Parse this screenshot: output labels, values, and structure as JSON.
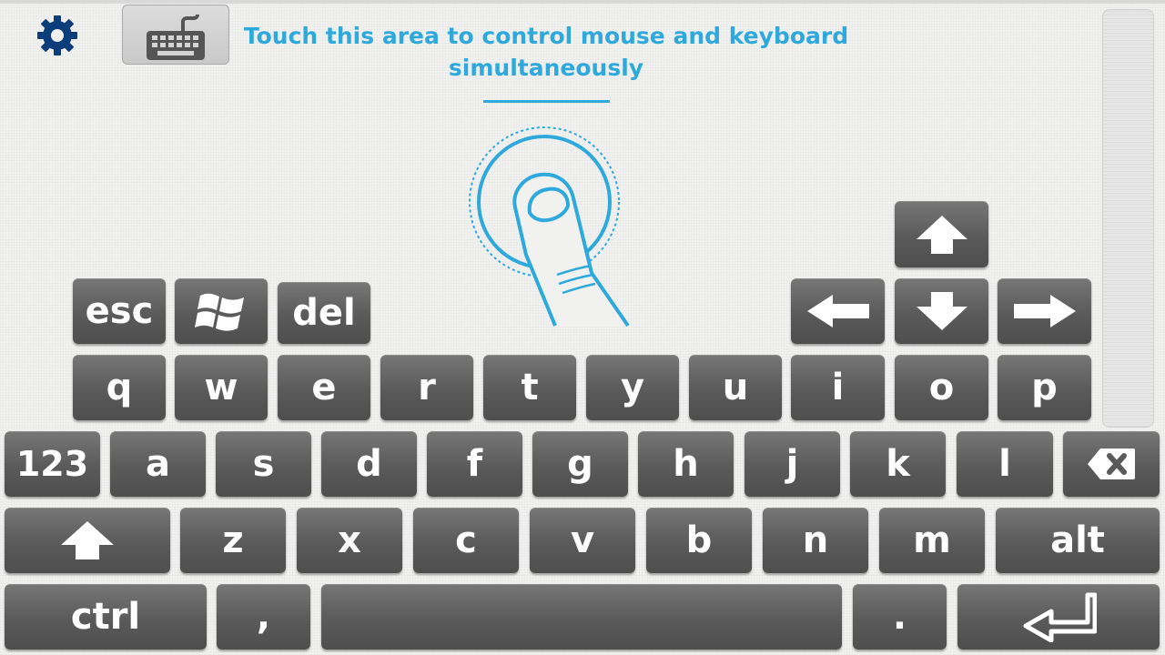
{
  "header": {
    "settings_icon": "gear-icon",
    "keyboard_icon": "keyboard-icon",
    "instruction": "Touch this area to control mouse and keyboard simultaneously"
  },
  "touchpad": {
    "icon": "touch-finger-icon"
  },
  "colors": {
    "accent": "#2fa9dc",
    "key": "#5a5a5a",
    "gear": "#0a3d7a",
    "background": "#f1f1f0"
  },
  "keyboard": {
    "nav_row": {
      "esc": "esc",
      "windows_icon": "windows-logo-icon",
      "del": "del"
    },
    "arrows": [
      "arrow-up-icon",
      "arrow-left-icon",
      "arrow-down-icon",
      "arrow-right-icon"
    ],
    "row1": [
      "q",
      "w",
      "e",
      "r",
      "t",
      "y",
      "u",
      "i",
      "o",
      "p"
    ],
    "row2": [
      "123",
      "a",
      "s",
      "d",
      "f",
      "g",
      "h",
      "j",
      "k",
      "l"
    ],
    "backspace_icon": "backspace-icon",
    "shift_icon": "shift-arrow-icon",
    "row3": [
      "z",
      "x",
      "c",
      "v",
      "b",
      "n",
      "m",
      "alt"
    ],
    "row4": {
      "ctrl": "ctrl",
      "comma": ",",
      "period": "."
    },
    "enter_icon": "enter-icon"
  }
}
